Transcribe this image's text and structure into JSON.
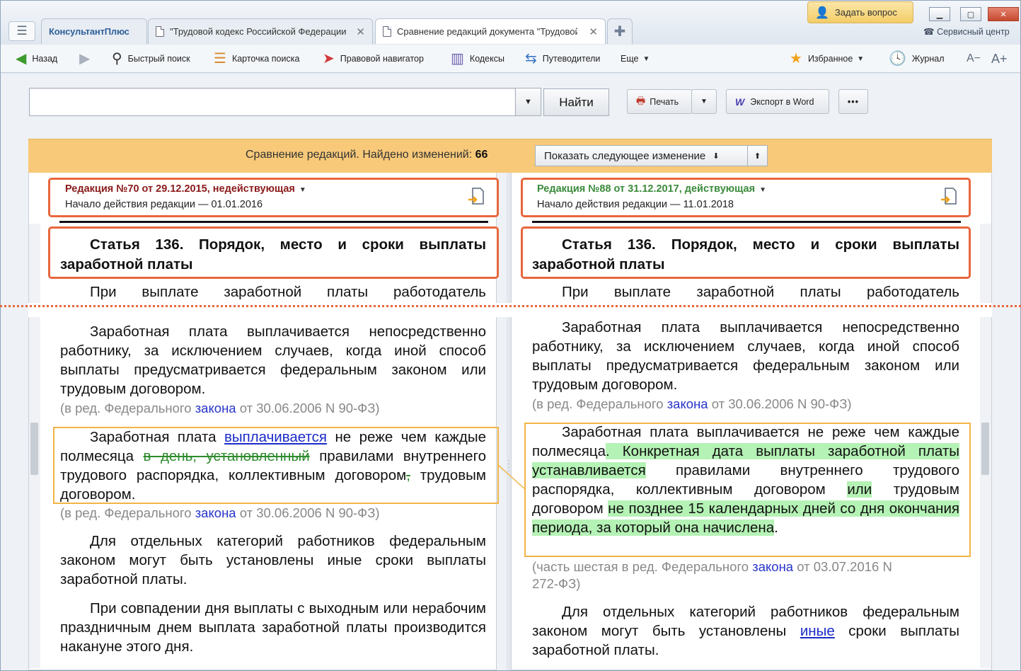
{
  "window": {
    "tabs": [
      {
        "label": "КонсультантПлюс"
      },
      {
        "label": "\"Трудовой кодекс Российской Федерации\""
      },
      {
        "label": "Сравнение редакций документа \"Трудовой кодекс\""
      }
    ],
    "ask_label": "Задать вопрос",
    "service_label": "Сервисный центр"
  },
  "toolbar": {
    "back": "Назад",
    "quick_search": "Быстрый поиск",
    "search_card": "Карточка поиска",
    "legal_navigator": "Правовой навигатор",
    "codes": "Кодексы",
    "guides": "Путеводители",
    "more": "Еще",
    "favorites": "Избранное",
    "journal": "Журнал",
    "font_smaller": "A−",
    "font_larger": "A+"
  },
  "search": {
    "value": "",
    "find_label": "Найти",
    "print_label": "Печать",
    "export_label": "Экспорт в Word",
    "more_label": "•••"
  },
  "compare": {
    "text": "Сравнение редакций. Найдено изменений:",
    "count": "66",
    "next_label": "Показать следующее изменение"
  },
  "left": {
    "version_title": "Редакция №70 от 29.12.2015, недействующая",
    "version_color": "#8b1a1a",
    "version_start": "Начало действия редакции — 01.01.2016",
    "article": "Статья 136. Порядок, место и сроки выплаты заработной платы",
    "p0": "При выплате заработной платы работодатель",
    "p1": "Заработная плата выплачивается непосредственно работнику, за исключением случаев, когда иной способ выплаты предусматривается федеральным законом или трудовым договором.",
    "n1_pre": "(в ред. Федерального ",
    "n1_link": "закона",
    "n1_post": " от 30.06.2006 N 90-ФЗ)",
    "p2": {
      "a": "Заработная плата ",
      "link": "выплачивается",
      "b": " не реже чем каждые полмесяца ",
      "del1": "в день, установленный",
      "c": " правилами внутреннего трудового распорядка, коллективным договором",
      "del2": ",",
      "d": " трудовым договором."
    },
    "n2_pre": "(в ред. Федерального ",
    "n2_link": "закона",
    "n2_post": " от 30.06.2006 N 90-ФЗ)",
    "p3": "Для отдельных категорий работников федеральным законом могут быть установлены иные сроки выплаты заработной платы.",
    "p4": "При совпадении дня выплаты с выходным или нерабочим праздничным днем выплата заработной платы производится накануне этого дня."
  },
  "right": {
    "version_title": "Редакция №88 от 31.12.2017, действующая",
    "version_color": "#3a8a3a",
    "version_start": "Начало действия редакции — 11.01.2018",
    "article": "Статья 136. Порядок, место и сроки выплаты заработной платы",
    "p0": "При выплате заработной платы работодатель",
    "p1": "Заработная плата выплачивается непосредственно работнику, за исключением случаев, когда иной способ выплаты предусматривается федеральным законом или трудовым договором.",
    "n1_pre": "(в ред. Федерального ",
    "n1_link": "закона",
    "n1_post": " от 30.06.2006 N 90-ФЗ)",
    "p2": {
      "a": "Заработная плата выплачивается не реже чем каждые полмесяца",
      "ins1": ". Конкретная дата выплаты заработной платы устанавливается",
      "b": " правилами внутреннего трудового распорядка, коллективным договором ",
      "ins2": "или",
      "c": " трудовым договором ",
      "ins3": "не позднее 15 календарных дней со дня окончания периода, за который она начислена",
      "d": "."
    },
    "n2_pre": "(часть шестая в ред. Федерального ",
    "n2_link": "закона",
    "n2_post_1": " от 03.07.2016 N",
    "n2_post_2": "272-ФЗ)",
    "p3_a": "Для отдельных категорий работников федеральным законом могут быть установлены ",
    "p3_link": "иные",
    "p3_b": "сроки выплаты заработной платы."
  }
}
